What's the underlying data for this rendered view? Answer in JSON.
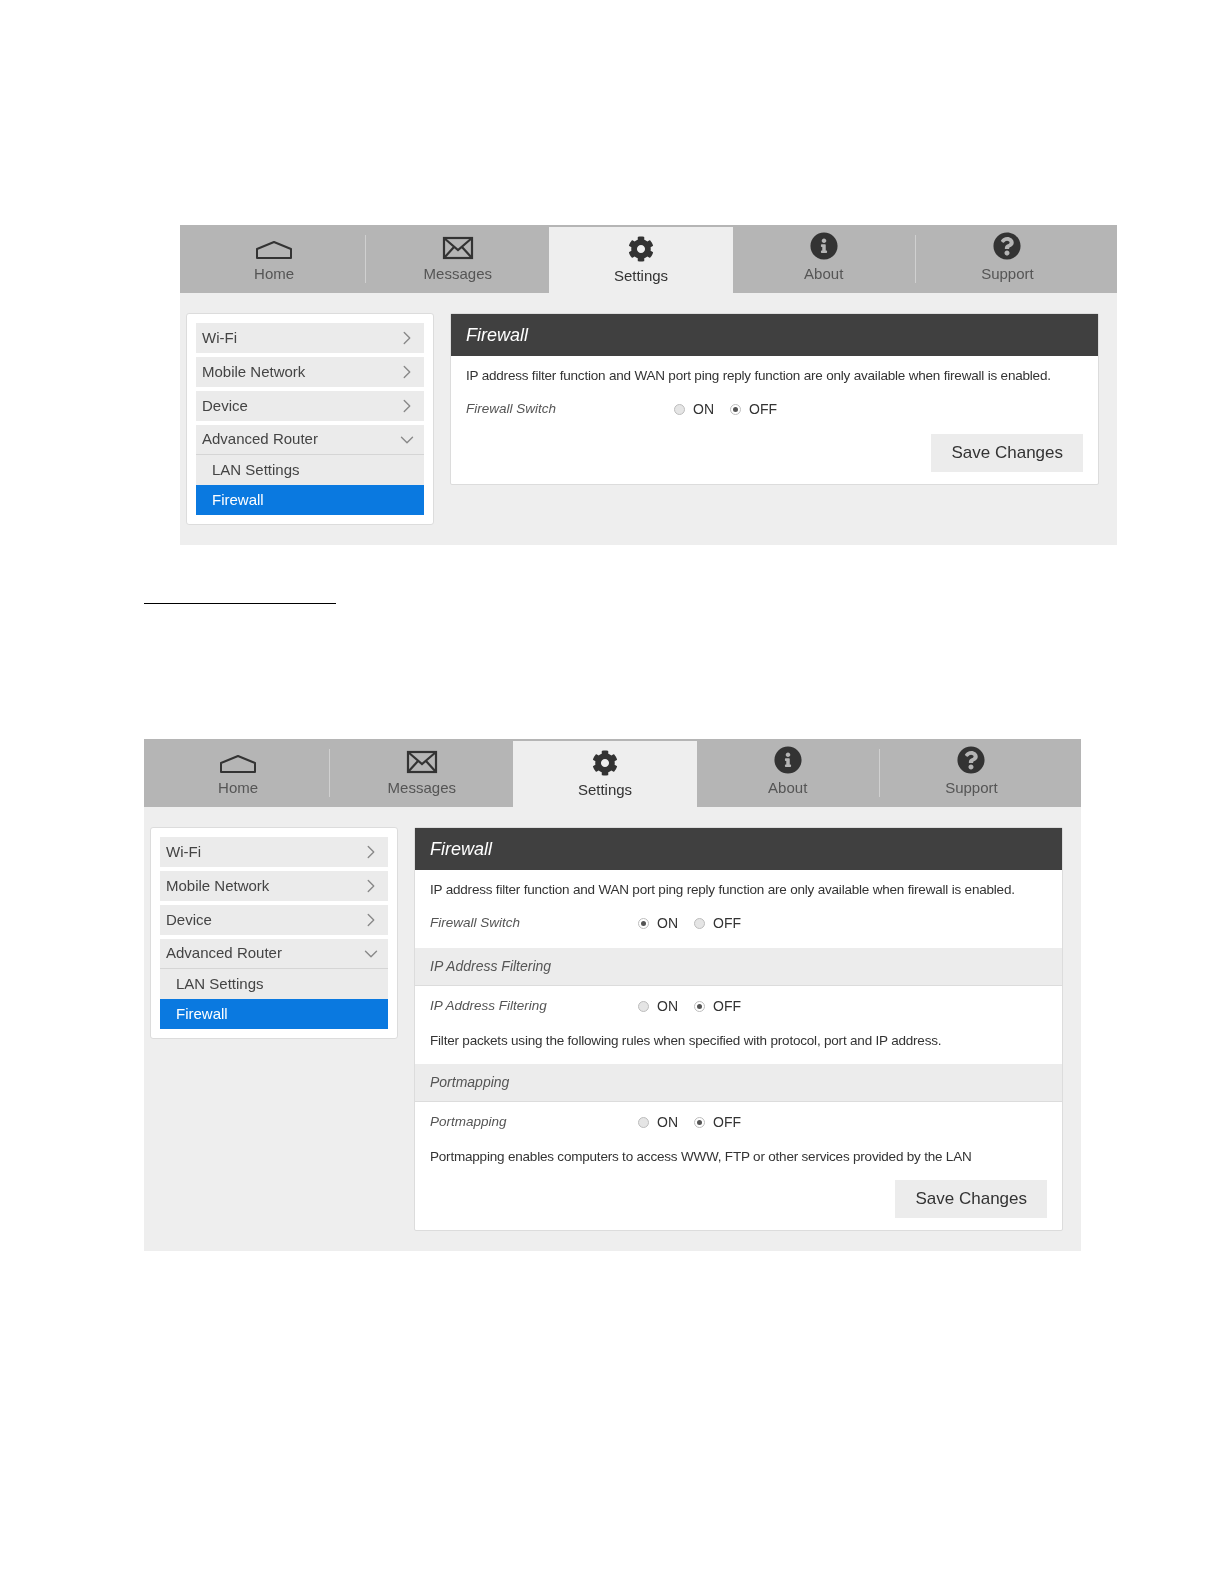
{
  "screenshots": [
    {
      "tabs": [
        {
          "label": "Home",
          "selected": false
        },
        {
          "label": "Messages",
          "selected": false
        },
        {
          "label": "Settings",
          "selected": true
        },
        {
          "label": "About",
          "selected": false
        },
        {
          "label": "Support",
          "selected": false
        }
      ],
      "menu": [
        {
          "label": "Wi-Fi",
          "kind": "link",
          "selected": false
        },
        {
          "label": "Mobile Network",
          "kind": "link",
          "selected": false
        },
        {
          "label": "Device",
          "kind": "link",
          "selected": false
        },
        {
          "label": "Advanced Router",
          "kind": "group",
          "expanded": true,
          "children": [
            {
              "label": "LAN Settings",
              "selected": false
            },
            {
              "label": "Firewall",
              "selected": true
            }
          ]
        }
      ],
      "panel": {
        "title": "Firewall",
        "sections": [
          {
            "rows": [
              {
                "kind": "text",
                "text": "IP address filter function and WAN port ping reply function are only available when firewall is enabled."
              },
              {
                "kind": "switch",
                "label": "Firewall Switch",
                "options": [
                  {
                    "label": "ON",
                    "selected": false
                  },
                  {
                    "label": "OFF",
                    "selected": true
                  }
                ]
              }
            ]
          }
        ],
        "save_button": "Save Changes"
      }
    },
    {
      "tabs": [
        {
          "label": "Home",
          "selected": false
        },
        {
          "label": "Messages",
          "selected": false
        },
        {
          "label": "Settings",
          "selected": true
        },
        {
          "label": "About",
          "selected": false
        },
        {
          "label": "Support",
          "selected": false
        }
      ],
      "menu": [
        {
          "label": "Wi-Fi",
          "kind": "link",
          "selected": false
        },
        {
          "label": "Mobile Network",
          "kind": "link",
          "selected": false
        },
        {
          "label": "Device",
          "kind": "link",
          "selected": false
        },
        {
          "label": "Advanced Router",
          "kind": "group",
          "expanded": true,
          "children": [
            {
              "label": "LAN Settings",
              "selected": false
            },
            {
              "label": "Firewall",
              "selected": true
            }
          ]
        }
      ],
      "panel": {
        "title": "Firewall",
        "sections": [
          {
            "rows": [
              {
                "kind": "text",
                "text": "IP address filter function and WAN port ping reply function are only available when firewall is enabled."
              },
              {
                "kind": "switch",
                "label": "Firewall Switch",
                "options": [
                  {
                    "label": "ON",
                    "selected": true
                  },
                  {
                    "label": "OFF",
                    "selected": false
                  }
                ]
              }
            ]
          },
          {
            "heading": "IP Address Filtering",
            "rows": [
              {
                "kind": "switch",
                "label": "IP Address Filtering",
                "options": [
                  {
                    "label": "ON",
                    "selected": false
                  },
                  {
                    "label": "OFF",
                    "selected": true
                  }
                ]
              },
              {
                "kind": "text",
                "text": "Filter packets using the following rules when specified with protocol, port and IP address."
              }
            ]
          },
          {
            "heading": "Portmapping",
            "rows": [
              {
                "kind": "switch",
                "label": "Portmapping",
                "options": [
                  {
                    "label": "ON",
                    "selected": false
                  },
                  {
                    "label": "OFF",
                    "selected": true
                  }
                ]
              },
              {
                "kind": "text",
                "text": "Portmapping enables computers to access WWW, FTP or other services provided by the LAN"
              }
            ]
          }
        ],
        "save_button": "Save Changes"
      }
    }
  ]
}
